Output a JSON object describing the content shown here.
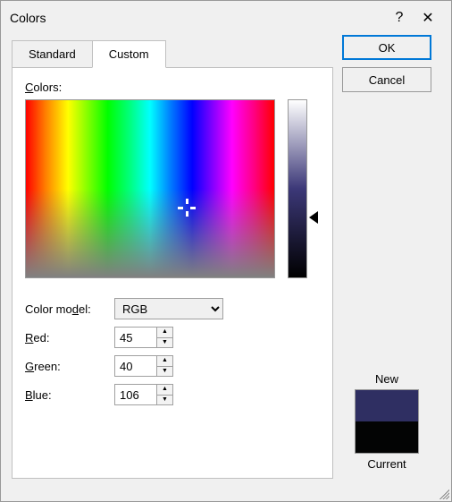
{
  "title": "Colors",
  "help": "?",
  "close": "✕",
  "tabs": {
    "standard": "Standard",
    "custom": "Custom"
  },
  "labels": {
    "colors": "Colors:",
    "model": "Color model:",
    "red": "Red:",
    "green": "Green:",
    "blue": "Blue:",
    "new": "New",
    "current": "Current"
  },
  "underlines": {
    "colors": "C",
    "model": "d",
    "red": "R",
    "green": "G",
    "blue": "B"
  },
  "model_value": "RGB",
  "rgb": {
    "r": "45",
    "g": "40",
    "b": "106"
  },
  "buttons": {
    "ok": "OK",
    "cancel": "Cancel"
  },
  "preview": {
    "new_color": "#2f2f62",
    "current_color": "#030404"
  }
}
